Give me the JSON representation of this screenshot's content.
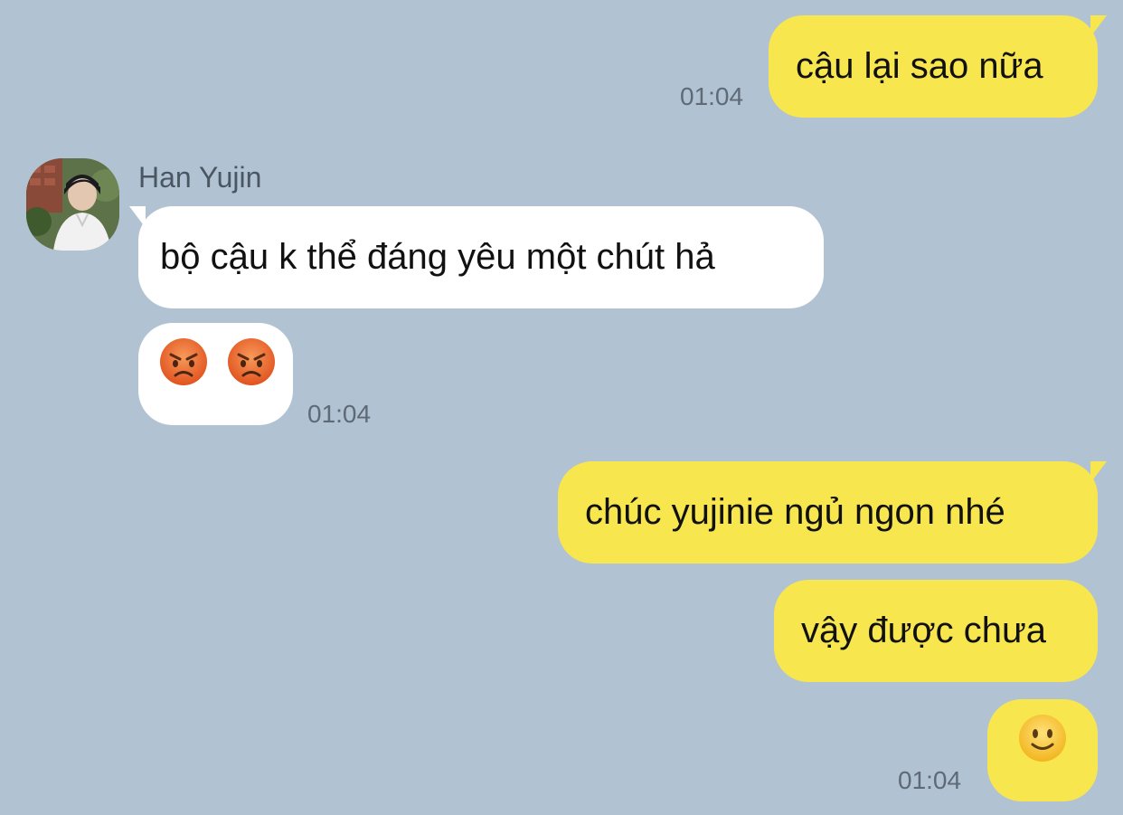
{
  "colors": {
    "background": "#b1c3d3",
    "outgoing_bubble": "#f8e64f",
    "incoming_bubble": "#ffffff",
    "timestamp": "#5e6a76"
  },
  "messages": [
    {
      "direction": "outgoing",
      "text": "cậu lại sao nữa",
      "time": "01:04"
    },
    {
      "direction": "incoming",
      "sender": "Han Yujin",
      "text": "bộ cậu k thể đáng yêu một chút hả"
    },
    {
      "direction": "incoming",
      "emoji": [
        "pouting-face",
        "pouting-face"
      ],
      "time": "01:04"
    },
    {
      "direction": "outgoing",
      "text": "chúc yujinie ngủ ngon nhé"
    },
    {
      "direction": "outgoing",
      "text": "vậy được chưa"
    },
    {
      "direction": "outgoing",
      "emoji": [
        "slightly-smiling-face"
      ],
      "time": "01:04"
    }
  ],
  "contact": {
    "name": "Han Yujin",
    "avatar_icon": "avatar-photo"
  }
}
